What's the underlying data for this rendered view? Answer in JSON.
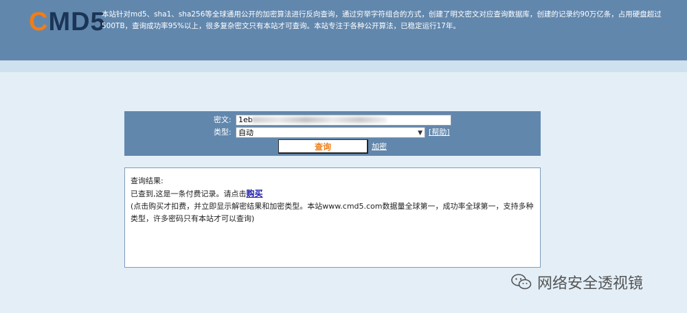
{
  "header": {
    "logo_first": "C",
    "logo_rest": "MD5",
    "intro_text": "本站针对md5、sha1、sha256等全球通用公开的加密算法进行反向查询，通过穷举字符组合的方式，创建了明文密文对应查询数据库，创建的记录约90万亿条，占用硬盘超过500TB，查询成功率95%以上，很多复杂密文只有本站才可查询。本站专注于各种公开算法，已稳定运行17年。"
  },
  "form": {
    "cipher_label": "密文:",
    "cipher_value": "1eb",
    "type_label": "类型:",
    "type_selected": "自动",
    "help_link": "[帮助]",
    "query_button": "查询",
    "encrypt_link": "加密"
  },
  "result": {
    "title": "查询结果:",
    "line1_prefix": "已查到,这是一条付费记录。请点击",
    "buy_link": "购买",
    "line2": "(点击购买才扣费，并立即显示解密结果和加密类型。本站www.cmd5.com数据量全球第一，成功率全球第一，支持多种类型，许多密码只有本站才可以查询)"
  },
  "watermark": {
    "text": "网络安全透视镜",
    "icon": "wechat-icon"
  }
}
